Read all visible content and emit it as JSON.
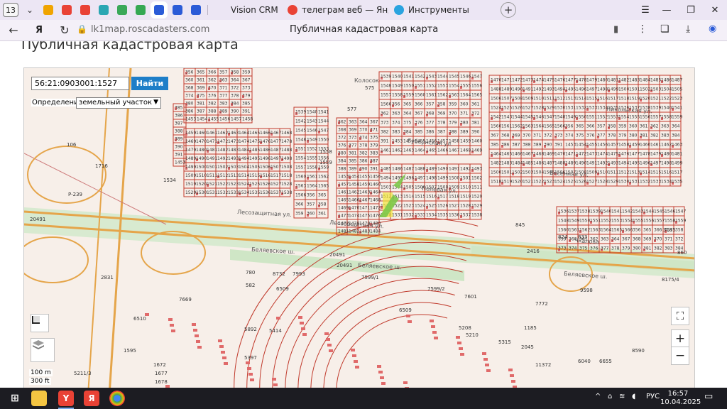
{
  "browser": {
    "tab_count": "13",
    "tabs": [
      {
        "label": "Vision CRM",
        "color": "#2b5bd7"
      },
      {
        "label": "телеграм веб — Яндекс:",
        "color": "#e94235"
      },
      {
        "label": "Инструменты",
        "color": "#2aa3df"
      }
    ],
    "pinned_colors": [
      "#f0a400",
      "#e94235",
      "#e94235",
      "#2aa6b3",
      "#3aa859",
      "#35a853",
      "#2b5bd7",
      "#2b5bd7",
      "#2b5bd7"
    ],
    "url": "lk1map.roscadasters.com",
    "page_tab_title": "Публичная кадастровая карта"
  },
  "page": {
    "heading": "Публичная кадастровая карта"
  },
  "map": {
    "search_value": "56:21:0903001:1527",
    "find_label": "Найти",
    "definition_label": "Определение:",
    "definition_value": "земельный участок",
    "zoom_in": "+",
    "zoom_out": "−",
    "scale_m": "100 m",
    "scale_ft": "300 ft",
    "streets": [
      "Беляевское ш.",
      "Беляевское ш.",
      "Беляевское ш.",
      "Лесозащитная ул.",
      "Лесозащитная ул.",
      "Чкалова",
      "Весенняя ул.",
      "Никольская ул.",
      "Колосок",
      "Губернская ул.",
      "Полевая ул."
    ],
    "parcel_numbers": [
      "356",
      "365",
      "366",
      "357",
      "358",
      "359",
      "360",
      "361",
      "362",
      "363",
      "364",
      "367",
      "368",
      "369",
      "370",
      "371",
      "372",
      "373",
      "374",
      "375",
      "376",
      "377",
      "378",
      "379",
      "380",
      "381",
      "382",
      "383",
      "384",
      "385",
      "386",
      "387",
      "388",
      "389",
      "390",
      "391",
      "1453",
      "1454",
      "1455",
      "1456",
      "1457",
      "1458",
      "1459",
      "1460",
      "1461",
      "1462",
      "1463",
      "1464",
      "1465",
      "1466",
      "1467",
      "1468",
      "1469",
      "1470",
      "1471",
      "1472",
      "1473",
      "1474",
      "1475",
      "1476",
      "1477",
      "1478",
      "1479",
      "1480",
      "1481",
      "1482",
      "1483",
      "1484",
      "1485",
      "1486",
      "1487",
      "1488",
      "1489",
      "1490",
      "1491",
      "1492",
      "1493",
      "1494",
      "1495",
      "1496",
      "1497",
      "1498",
      "1499",
      "1500",
      "1501",
      "1502",
      "1503",
      "1504",
      "1505",
      "1506",
      "1507",
      "1508",
      "1509",
      "1510",
      "1511",
      "1512",
      "1513",
      "1514",
      "1515",
      "1516",
      "1517",
      "1518",
      "1519",
      "1520",
      "1521",
      "1522",
      "1523",
      "1524",
      "1525",
      "1526",
      "1527",
      "1528",
      "1529",
      "1530",
      "1531",
      "1532",
      "1533",
      "1534",
      "1535",
      "1536",
      "1537",
      "1538",
      "1539",
      "1540",
      "1541",
      "1542",
      "1543",
      "1544",
      "1545",
      "1546",
      "1547",
      "1548",
      "1549",
      "1550",
      "1551",
      "1552",
      "1553",
      "1554",
      "1555",
      "1556",
      "1557",
      "1558",
      "1559",
      "1560",
      "1561",
      "1562",
      "1563",
      "1564",
      "1565",
      "1566"
    ],
    "labels": [
      {
        "t": "575"
      },
      {
        "t": "577"
      },
      {
        "t": "1716"
      },
      {
        "t": "106"
      },
      {
        "t": "P-239"
      },
      {
        "t": "20491"
      },
      {
        "t": "20491"
      },
      {
        "t": "20491"
      },
      {
        "t": "780"
      },
      {
        "t": "582"
      },
      {
        "t": "8732"
      },
      {
        "t": "7993"
      },
      {
        "t": "2831"
      },
      {
        "t": "7669"
      },
      {
        "t": "6509"
      },
      {
        "t": "6509"
      },
      {
        "t": "7599/1"
      },
      {
        "t": "7599/2"
      },
      {
        "t": "7601"
      },
      {
        "t": "7772"
      },
      {
        "t": "2416"
      },
      {
        "t": "845"
      },
      {
        "t": "824"
      },
      {
        "t": "833"
      },
      {
        "t": "860"
      },
      {
        "t": "9598"
      },
      {
        "t": "6510"
      },
      {
        "t": "5208"
      },
      {
        "t": "5210"
      },
      {
        "t": "5315"
      },
      {
        "t": "1185"
      },
      {
        "t": "8590"
      },
      {
        "t": "6040"
      },
      {
        "t": "6655"
      },
      {
        "t": "5397"
      },
      {
        "t": "5211/3"
      },
      {
        "t": "1672"
      },
      {
        "t": "1677"
      },
      {
        "t": "1678"
      },
      {
        "t": "1679"
      },
      {
        "t": "1595"
      },
      {
        "t": "5892"
      },
      {
        "t": "5414"
      },
      {
        "t": "11372"
      },
      {
        "t": "2045"
      },
      {
        "t": "8175/4"
      },
      {
        "t": "3185"
      },
      {
        "t": "1534"
      },
      {
        "t": "1558"
      },
      {
        "t": "1559"
      }
    ]
  },
  "taskbar": {
    "lang": "РУС",
    "time": "16:57",
    "date": "10.04.2025"
  }
}
